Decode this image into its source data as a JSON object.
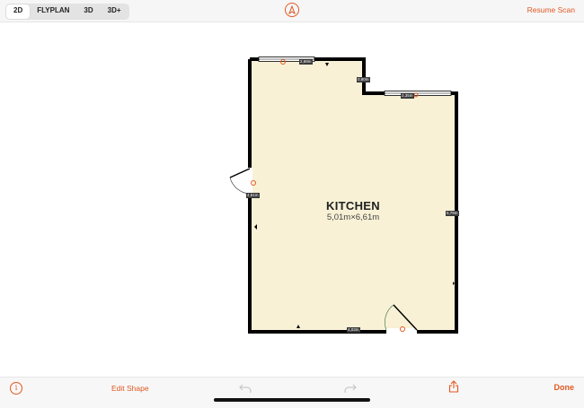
{
  "toolbar": {
    "view_modes": [
      "2D",
      "FLYPLAN",
      "3D",
      "3D+"
    ],
    "active_mode": "2D",
    "resume_label": "Resume Scan",
    "compass_icon": "compass-icon"
  },
  "room": {
    "name": "KITCHEN",
    "size": "5,01m×6,61m",
    "fill_color": "#f8f1d6",
    "wall_color": "#000000",
    "dimensions": {
      "top_window": "2,69m",
      "step_down": "0,80m",
      "right_window": "2,35m",
      "left_wall": "4,61m",
      "right_wall": "5,79m",
      "bottom_wall": "4,03m"
    }
  },
  "bottom": {
    "edit_shape_label": "Edit Shape",
    "done_label": "Done",
    "info_icon": "info-icon",
    "undo_icon": "undo-icon",
    "redo_icon": "redo-icon",
    "share_icon": "share-icon"
  },
  "colors": {
    "accent": "#e25822",
    "bar_bg": "#f6f6f6"
  }
}
